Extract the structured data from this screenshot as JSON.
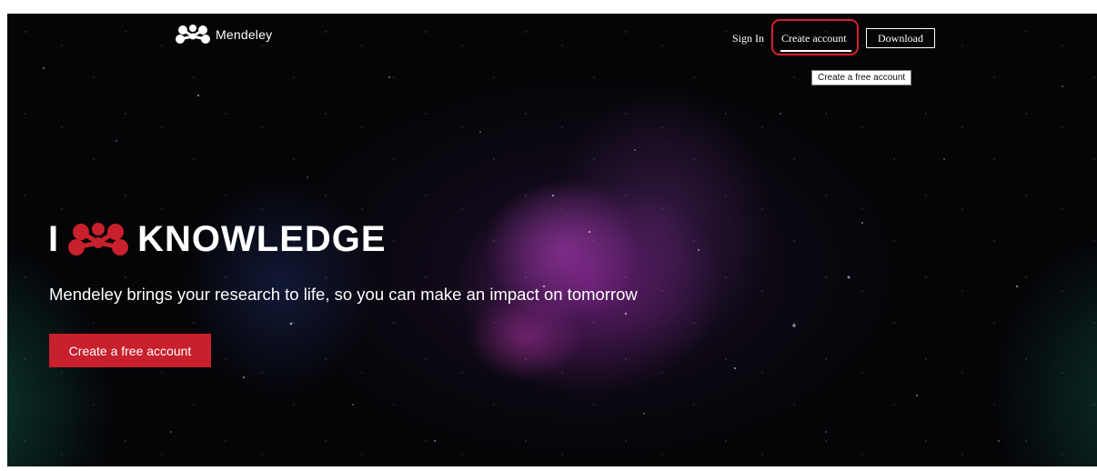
{
  "header": {
    "brand": "Mendeley",
    "sign_in_label": "Sign In",
    "create_account_label": "Create account",
    "download_label": "Download",
    "tooltip": "Create a free account"
  },
  "hero": {
    "title_prefix": "I",
    "title_word": "KNOWLEDGE",
    "subtitle": "Mendeley brings your research to life, so you can make an impact on tomorrow",
    "cta_label": "Create a free account"
  },
  "icons": {
    "brand_logo": "mendeley-logo-icon",
    "hero_logo": "mendeley-heart-logo-icon"
  },
  "colors": {
    "accent_red": "#c8202c",
    "highlight_ring": "#d8202a",
    "background": "#050508",
    "text": "#ffffff"
  }
}
